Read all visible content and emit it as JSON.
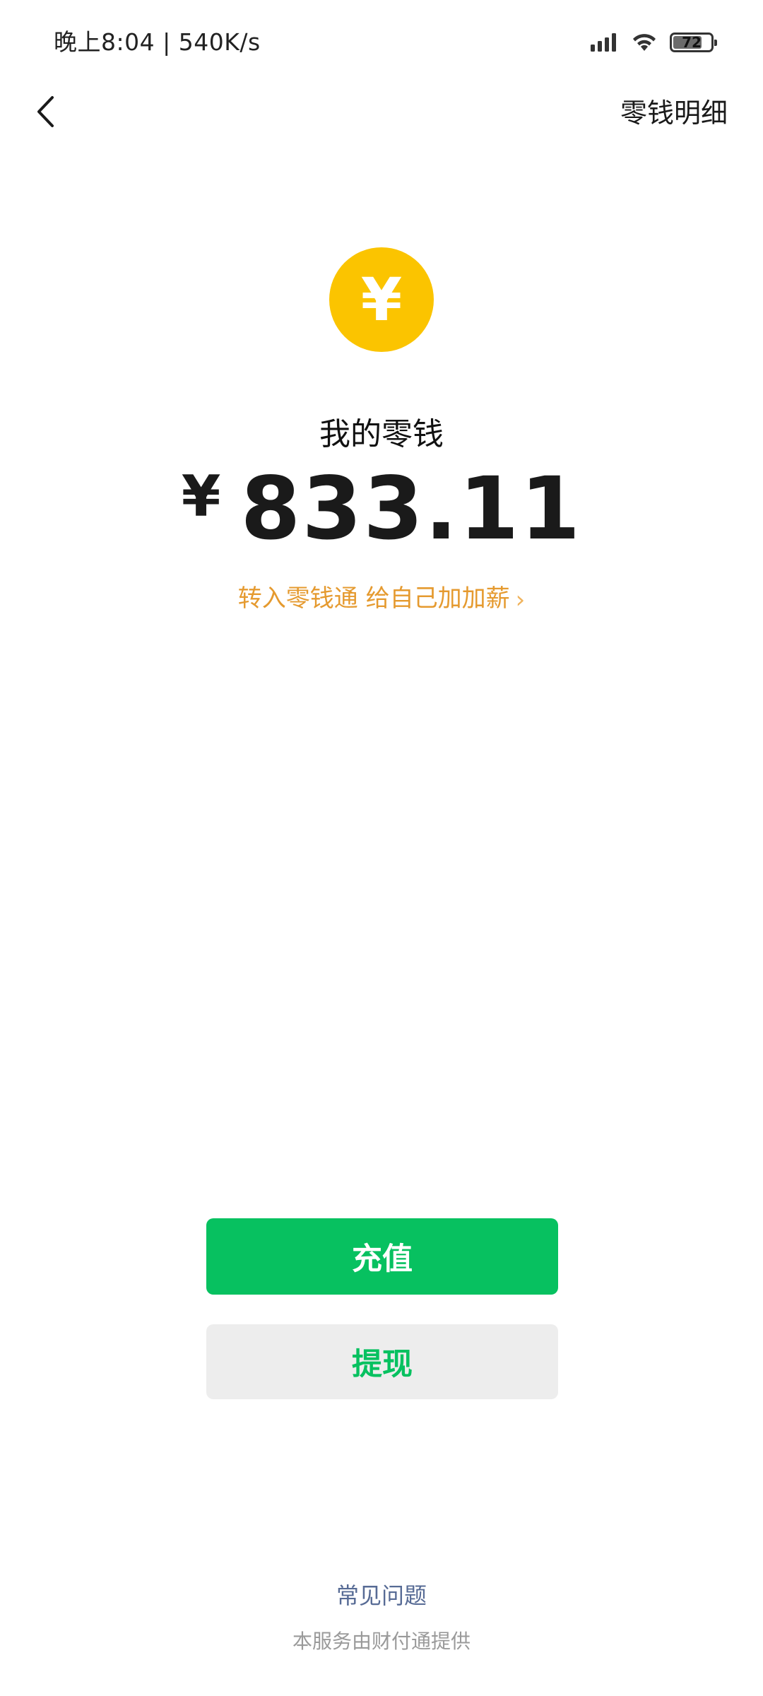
{
  "status_bar": {
    "time_speed": "晚上8:04 | 540K/s",
    "battery_level": "72",
    "icons": [
      "signal-icon",
      "wifi-icon",
      "battery-icon"
    ]
  },
  "nav": {
    "back_icon": "chevron-left-icon",
    "details_label": "零钱明细"
  },
  "balance": {
    "coin_symbol": "¥",
    "label": "我的零钱",
    "currency": "¥",
    "amount": "833.11"
  },
  "promo": {
    "label": "转入零钱通 给自己加加薪",
    "chevron": "›"
  },
  "actions": {
    "recharge_label": "充值",
    "withdraw_label": "提现"
  },
  "footer": {
    "faq_label": "常见问题",
    "provider_note": "本服务由财付通提供"
  },
  "colors": {
    "coin": "#fbc400",
    "primary_green": "#07c160",
    "secondary_bg": "#ededed",
    "promo_orange": "#e59a2f",
    "link_blue": "#576b95",
    "note_gray": "#9a9a9a"
  }
}
